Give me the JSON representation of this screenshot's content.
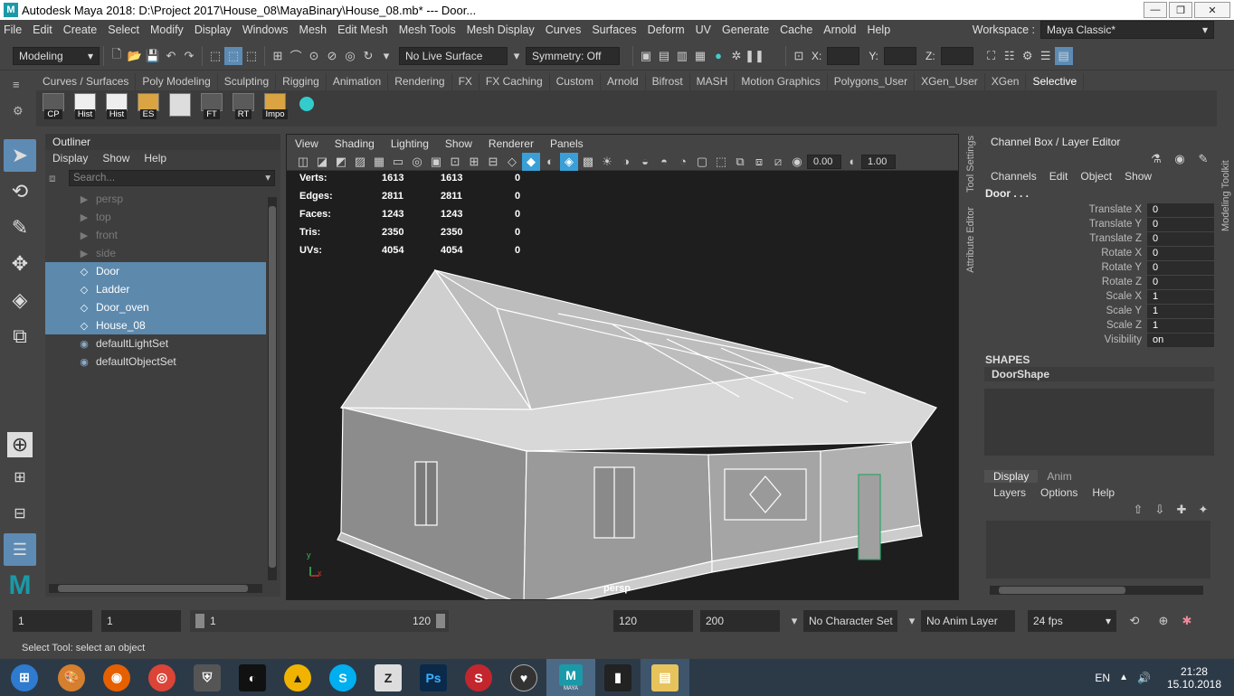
{
  "title": "Autodesk Maya 2018: D:\\Project 2017\\House_08\\MayaBinary\\House_08.mb*   ---   Door...",
  "window_controls": {
    "minimize": "—",
    "maximize": "❐",
    "close": "✕"
  },
  "menu": [
    "File",
    "Edit",
    "Create",
    "Select",
    "Modify",
    "Display",
    "Windows",
    "Mesh",
    "Edit Mesh",
    "Mesh Tools",
    "Mesh Display",
    "Curves",
    "Surfaces",
    "Deform",
    "UV",
    "Generate",
    "Cache",
    "Arnold",
    "Help"
  ],
  "workspace": {
    "label": "Workspace :",
    "value": "Maya Classic*"
  },
  "status": {
    "mode": "Modeling",
    "live_surface": "No Live Surface",
    "symmetry": "Symmetry: Off",
    "x_label": "X:",
    "y_label": "Y:",
    "z_label": "Z:"
  },
  "shelf_tabs": [
    "Curves / Surfaces",
    "Poly Modeling",
    "Sculpting",
    "Rigging",
    "Animation",
    "Rendering",
    "FX",
    "FX Caching",
    "Custom",
    "Arnold",
    "Bifrost",
    "MASH",
    "Motion Graphics",
    "Polygons_User",
    "XGen_User",
    "XGen",
    "Selective"
  ],
  "shelf_active_tab": "Selective",
  "shelf_buttons": [
    "CP",
    "Hist",
    "Hist",
    "ES",
    "",
    "FT",
    "RT",
    "Impo"
  ],
  "outliner": {
    "title": "Outliner",
    "menu": [
      "Display",
      "Show",
      "Help"
    ],
    "search_placeholder": "Search...",
    "items": [
      {
        "name": "persp",
        "kind": "cam"
      },
      {
        "name": "top",
        "kind": "cam"
      },
      {
        "name": "front",
        "kind": "cam"
      },
      {
        "name": "side",
        "kind": "cam"
      },
      {
        "name": "Door",
        "kind": "sel"
      },
      {
        "name": "Ladder",
        "kind": "sel"
      },
      {
        "name": "Door_oven",
        "kind": "sel"
      },
      {
        "name": "House_08",
        "kind": "sel"
      },
      {
        "name": "defaultLightSet",
        "kind": "set"
      },
      {
        "name": "defaultObjectSet",
        "kind": "set"
      }
    ]
  },
  "viewport": {
    "menu": [
      "View",
      "Shading",
      "Lighting",
      "Show",
      "Renderer",
      "Panels"
    ],
    "field_a": "0.00",
    "field_b": "1.00",
    "camera_label": "persp",
    "axis_y": "y",
    "axis_x": "x",
    "stats": [
      {
        "label": "Verts:",
        "a": "1613",
        "b": "1613",
        "c": "0"
      },
      {
        "label": "Edges:",
        "a": "2811",
        "b": "2811",
        "c": "0"
      },
      {
        "label": "Faces:",
        "a": "1243",
        "b": "1243",
        "c": "0"
      },
      {
        "label": "Tris:",
        "a": "2350",
        "b": "2350",
        "c": "0"
      },
      {
        "label": "UVs:",
        "a": "4054",
        "b": "4054",
        "c": "0"
      }
    ]
  },
  "side_tabs_left": [
    "Tool Settings",
    "Attribute Editor"
  ],
  "side_tab_right": "Modeling Toolkit",
  "channel_box": {
    "title": "Channel Box / Layer Editor",
    "menu": [
      "Channels",
      "Edit",
      "Object",
      "Show"
    ],
    "object": "Door . . .",
    "channels": [
      {
        "label": "Translate X",
        "value": "0"
      },
      {
        "label": "Translate Y",
        "value": "0"
      },
      {
        "label": "Translate Z",
        "value": "0"
      },
      {
        "label": "Rotate X",
        "value": "0"
      },
      {
        "label": "Rotate Y",
        "value": "0"
      },
      {
        "label": "Rotate Z",
        "value": "0"
      },
      {
        "label": "Scale X",
        "value": "1"
      },
      {
        "label": "Scale Y",
        "value": "1"
      },
      {
        "label": "Scale Z",
        "value": "1"
      },
      {
        "label": "Visibility",
        "value": "on"
      }
    ],
    "shapes_label": "SHAPES",
    "shape_name": "DoorShape",
    "layer_tabs": [
      "Display",
      "Anim"
    ],
    "layer_menu": [
      "Layers",
      "Options",
      "Help"
    ]
  },
  "time": {
    "start": "1",
    "current": "1",
    "range_start": "1",
    "range_end": "120",
    "end": "120",
    "anim_end": "200",
    "character_set": "No Character Set",
    "anim_layer": "No Anim Layer",
    "fps": "24 fps"
  },
  "help_line": "Select Tool: select an object",
  "taskbar": {
    "lang": "EN",
    "time": "21:28",
    "date": "15.10.2018",
    "maya_label": "MAYA"
  }
}
